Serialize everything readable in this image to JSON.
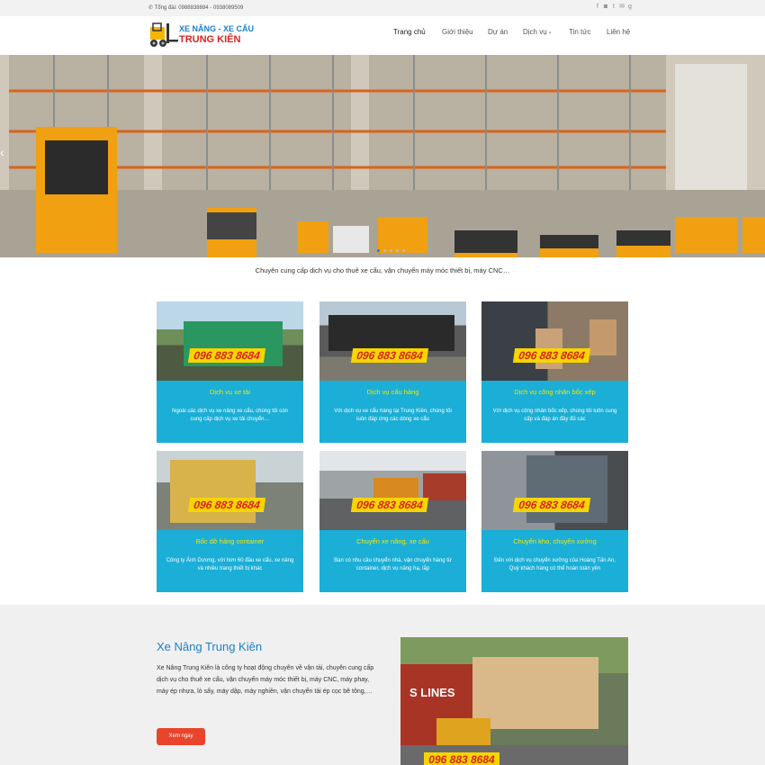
{
  "topbar": {
    "phone_icon": "phone-icon",
    "phone_text": "Tổng đài: 0988838884 - 0938089509",
    "socials": [
      "facebook-icon",
      "instagram-icon",
      "twitter-icon",
      "email-icon",
      "googleplus-icon"
    ]
  },
  "logo": {
    "line1": "XE NÂNG - XE CẨU",
    "line2": "TRUNG KIÊN"
  },
  "nav": {
    "home": "Trang chủ",
    "about": "Giới thiệu",
    "projects": "Dự án",
    "services": "Dịch vụ",
    "news": "Tin tức",
    "contact": "Liên hệ"
  },
  "hero": {
    "slides": 5,
    "active_slide": 1
  },
  "tagline": "Chuyên cung cấp dịch vụ cho thuê xe cẩu, vận chuyển máy móc thiết bị, máy CNC…",
  "phone_badge": "096 883 8684",
  "cards": [
    {
      "title": "Dịch vụ xe tải",
      "desc": "Ngoài các dịch vụ xe nâng xe cẩu, chúng tôi còn cung cấp dịch vụ xe tải chuyển…"
    },
    {
      "title": "Dịch vụ cẩu hàng",
      "desc": "Với dịch vụ xe cẩu hàng tại Trung Kiên, chúng tôi luôn đáp ứng các dòng xe cẩu"
    },
    {
      "title": "Dịch vụ công nhân bốc xếp",
      "desc": "Với dịch vụ công nhân bốc xếp, chúng tôi luôn cung cấp và đáp án đầy đủ các"
    },
    {
      "title": "Bốc dỡ hàng container",
      "desc": "Công ty Ánh Dương, với hơn 60 đầu xe cẩu, xe nâng và nhiều trang thiết bị khác"
    },
    {
      "title": "Chuyển xe nâng, xe cẩu",
      "desc": "Bạn có nhu cầu chuyển nhà, vận chuyển hàng từ container, dịch vụ nâng hạ, lắp"
    },
    {
      "title": "Chuyển kho, chuyển xưởng",
      "desc": "Đến với dịch vụ chuyển xưởng của Hoàng Tấn An, Quý khách hàng có thể hoàn toàn yên"
    }
  ],
  "about": {
    "title": "Xe Nâng Trung Kiên",
    "text": "Xe Nâng Trung Kiên là công ty hoạt động chuyên về vận tải, chuyên cung cấp dịch vụ cho thuê xe cẩu, vận chuyển máy móc thiết bị, máy CNC, máy phay, máy ép nhựa, lò sấy, máy dập, máy nghiền, vận chuyển tải ép cọc bê tông,…",
    "button": "Xem ngay",
    "photo_text": "S LINES"
  },
  "colors": {
    "accent": "#1baed6",
    "brand_blue": "#1b7fc4",
    "brand_red": "#d9241c",
    "badge_yellow": "#f7d500",
    "button_red": "#e8452c"
  }
}
